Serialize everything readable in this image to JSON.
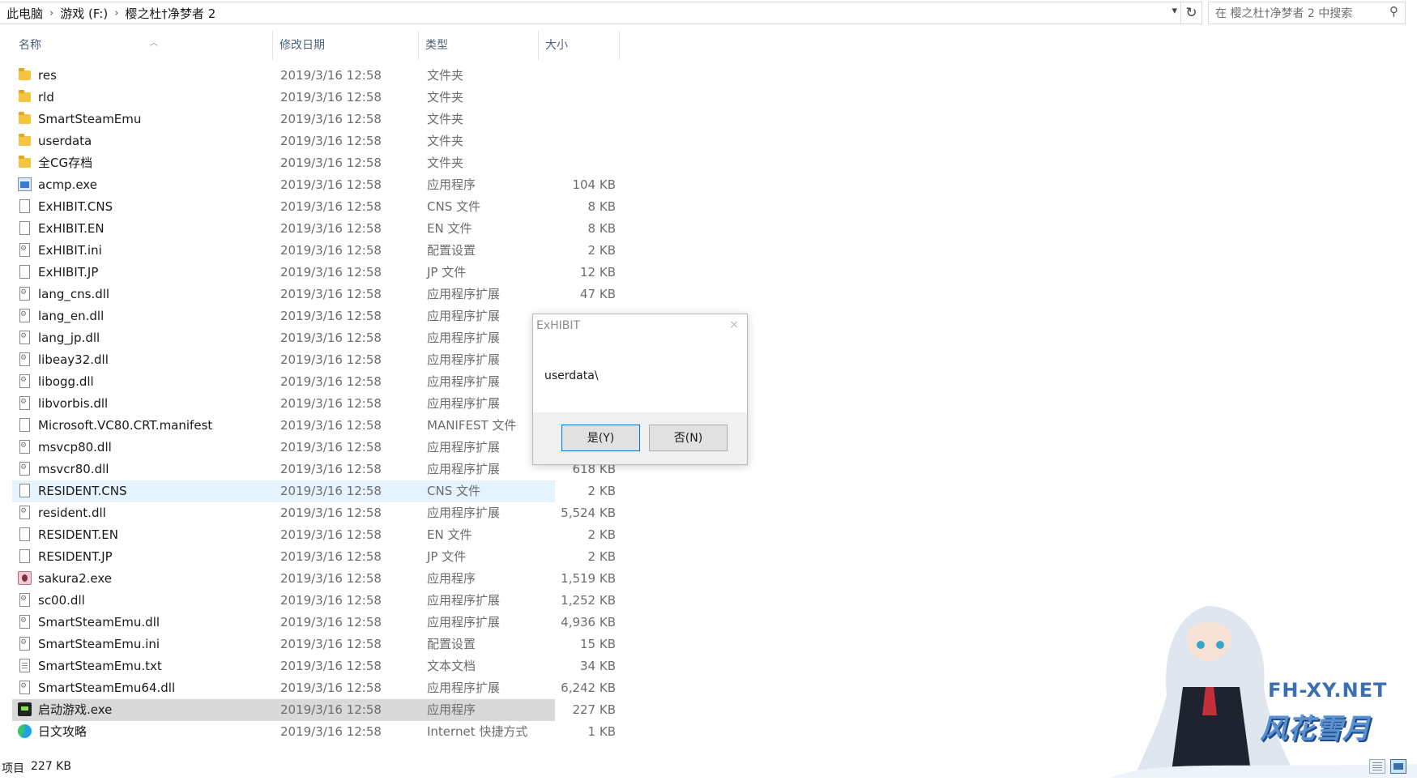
{
  "address": {
    "breadcrumbs": [
      "此电脑",
      "游戏 (F:)",
      "樱之杜†净梦者 2"
    ],
    "separator": "›",
    "search_placeholder": "在 樱之杜†净梦者 2 中搜索"
  },
  "columns": {
    "name": "名称",
    "date": "修改日期",
    "type": "类型",
    "size": "大小"
  },
  "files": [
    {
      "name": "res",
      "date": "2019/3/16 12:58",
      "type": "文件夹",
      "size": "",
      "icon": "folder-icon"
    },
    {
      "name": "rld",
      "date": "2019/3/16 12:58",
      "type": "文件夹",
      "size": "",
      "icon": "folder-icon"
    },
    {
      "name": "SmartSteamEmu",
      "date": "2019/3/16 12:58",
      "type": "文件夹",
      "size": "",
      "icon": "folder-icon"
    },
    {
      "name": "userdata",
      "date": "2019/3/16 12:58",
      "type": "文件夹",
      "size": "",
      "icon": "folder-icon"
    },
    {
      "name": "全CG存档",
      "date": "2019/3/16 12:58",
      "type": "文件夹",
      "size": "",
      "icon": "folder-icon"
    },
    {
      "name": "acmp.exe",
      "date": "2019/3/16 12:58",
      "type": "应用程序",
      "size": "104 KB",
      "icon": "exe-icon"
    },
    {
      "name": "ExHIBIT.CNS",
      "date": "2019/3/16 12:58",
      "type": "CNS 文件",
      "size": "8 KB",
      "icon": "file-icon"
    },
    {
      "name": "ExHIBIT.EN",
      "date": "2019/3/16 12:58",
      "type": "EN 文件",
      "size": "8 KB",
      "icon": "file-icon"
    },
    {
      "name": "ExHIBIT.ini",
      "date": "2019/3/16 12:58",
      "type": "配置设置",
      "size": "2 KB",
      "icon": "ini-icon"
    },
    {
      "name": "ExHIBIT.JP",
      "date": "2019/3/16 12:58",
      "type": "JP 文件",
      "size": "12 KB",
      "icon": "file-icon"
    },
    {
      "name": "lang_cns.dll",
      "date": "2019/3/16 12:58",
      "type": "应用程序扩展",
      "size": "47 KB",
      "icon": "dll-icon"
    },
    {
      "name": "lang_en.dll",
      "date": "2019/3/16 12:58",
      "type": "应用程序扩展",
      "size": "",
      "icon": "dll-icon"
    },
    {
      "name": "lang_jp.dll",
      "date": "2019/3/16 12:58",
      "type": "应用程序扩展",
      "size": "",
      "icon": "dll-icon"
    },
    {
      "name": "libeay32.dll",
      "date": "2019/3/16 12:58",
      "type": "应用程序扩展",
      "size": "",
      "icon": "dll-icon"
    },
    {
      "name": "libogg.dll",
      "date": "2019/3/16 12:58",
      "type": "应用程序扩展",
      "size": "",
      "icon": "dll-icon"
    },
    {
      "name": "libvorbis.dll",
      "date": "2019/3/16 12:58",
      "type": "应用程序扩展",
      "size": "",
      "icon": "dll-icon"
    },
    {
      "name": "Microsoft.VC80.CRT.manifest",
      "date": "2019/3/16 12:58",
      "type": "MANIFEST 文件",
      "size": "",
      "icon": "file-icon"
    },
    {
      "name": "msvcp80.dll",
      "date": "2019/3/16 12:58",
      "type": "应用程序扩展",
      "size": "",
      "icon": "dll-icon"
    },
    {
      "name": "msvcr80.dll",
      "date": "2019/3/16 12:58",
      "type": "应用程序扩展",
      "size": "618 KB",
      "icon": "dll-icon"
    },
    {
      "name": "RESIDENT.CNS",
      "date": "2019/3/16 12:58",
      "type": "CNS 文件",
      "size": "2 KB",
      "icon": "file-icon",
      "state": "hover"
    },
    {
      "name": "resident.dll",
      "date": "2019/3/16 12:58",
      "type": "应用程序扩展",
      "size": "5,524 KB",
      "icon": "dll-icon"
    },
    {
      "name": "RESIDENT.EN",
      "date": "2019/3/16 12:58",
      "type": "EN 文件",
      "size": "2 KB",
      "icon": "file-icon"
    },
    {
      "name": "RESIDENT.JP",
      "date": "2019/3/16 12:58",
      "type": "JP 文件",
      "size": "2 KB",
      "icon": "file-icon"
    },
    {
      "name": "sakura2.exe",
      "date": "2019/3/16 12:58",
      "type": "应用程序",
      "size": "1,519 KB",
      "icon": "sakura-exe-icon"
    },
    {
      "name": "sc00.dll",
      "date": "2019/3/16 12:58",
      "type": "应用程序扩展",
      "size": "1,252 KB",
      "icon": "dll-icon"
    },
    {
      "name": "SmartSteamEmu.dll",
      "date": "2019/3/16 12:58",
      "type": "应用程序扩展",
      "size": "4,936 KB",
      "icon": "dll-icon"
    },
    {
      "name": "SmartSteamEmu.ini",
      "date": "2019/3/16 12:58",
      "type": "配置设置",
      "size": "15 KB",
      "icon": "ini-icon"
    },
    {
      "name": "SmartSteamEmu.txt",
      "date": "2019/3/16 12:58",
      "type": "文本文档",
      "size": "34 KB",
      "icon": "txt-icon"
    },
    {
      "name": "SmartSteamEmu64.dll",
      "date": "2019/3/16 12:58",
      "type": "应用程序扩展",
      "size": "6,242 KB",
      "icon": "dll-icon"
    },
    {
      "name": "启动游戏.exe",
      "date": "2019/3/16 12:58",
      "type": "应用程序",
      "size": "227 KB",
      "icon": "launcher-icon",
      "state": "selected"
    },
    {
      "name": "日文攻略",
      "date": "2019/3/16 12:58",
      "type": "Internet 快捷方式",
      "size": "1 KB",
      "icon": "edge-icon"
    }
  ],
  "dialog": {
    "title": "ExHIBIT",
    "close": "×",
    "message": "userdata\\",
    "yes_label": "是(Y)",
    "no_label": "否(N)"
  },
  "status": {
    "count": "项目",
    "selected_size": "227 KB"
  },
  "watermark": {
    "site": "FH-XY.NET",
    "name": "风花雪月"
  },
  "colors": {
    "hover_row": "#e5f3ff",
    "selected_row": "#d9d9d9",
    "header_text": "#4c607a"
  }
}
